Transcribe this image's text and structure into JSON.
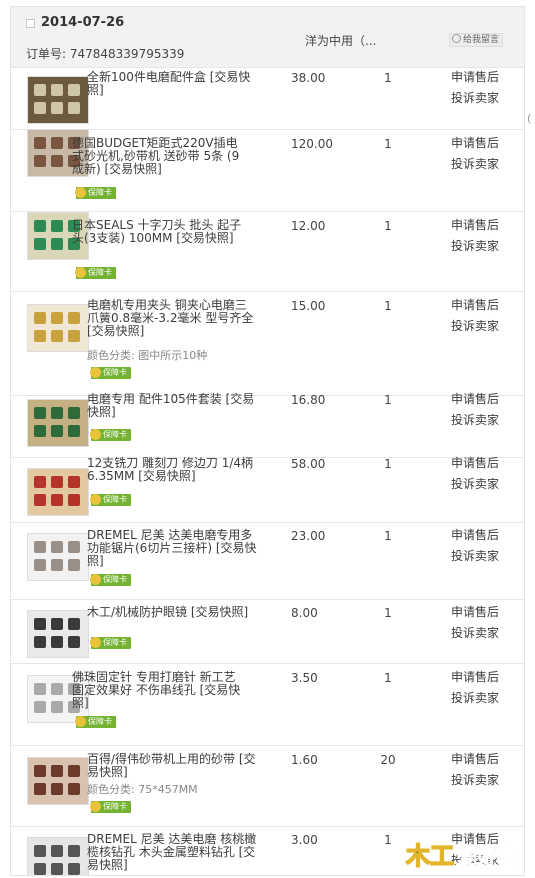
{
  "order": {
    "date": "2014-07-26",
    "order_no": "订单号: 747848339795339",
    "seller": "洋为中用（...",
    "memo": "给我留言"
  },
  "side_char": "(",
  "badge_label": "保障卡",
  "actions": {
    "apply": "申请售后",
    "complain": "投诉卖家"
  },
  "items": [
    {
      "title": "全新100件电磨配件盒 [交易快照]",
      "sku": "",
      "price": "38.00",
      "qty": "1",
      "thumb_colors": [
        "#cfc5a8",
        "#6c5a3c"
      ]
    },
    {
      "title": "德国BUDGET矩距式220V插电式砂光机,砂带机 送砂带 5条 (9成新) [交易快照]",
      "sku": "",
      "price": "120.00",
      "qty": "1",
      "thumb_colors": [
        "#7a5540",
        "#c8b9a6"
      ]
    },
    {
      "title": "日本SEALS 十字刀头 批头 起子头(3支装) 100MM [交易快照]",
      "sku": "",
      "price": "12.00",
      "qty": "1",
      "thumb_colors": [
        "#2d8a54",
        "#d9d7b8"
      ]
    },
    {
      "title": "电磨机专用夹头 铜夹心电磨三爪簧0.8毫米-3.2毫米 型号齐全 [交易快照]",
      "sku": "颜色分类: 图中所示10种",
      "price": "15.00",
      "qty": "1",
      "thumb_colors": [
        "#c9a23e",
        "#f0e8d4"
      ]
    },
    {
      "title": "电磨专用 配件105件套装 [交易快照]",
      "sku": "",
      "price": "16.80",
      "qty": "1",
      "thumb_colors": [
        "#2f6b3a",
        "#c4b083"
      ]
    },
    {
      "title": "12支铣刀 雕刻刀 修边刀 1/4柄 6.35MM [交易快照]",
      "sku": "",
      "price": "58.00",
      "qty": "1",
      "thumb_colors": [
        "#b5342a",
        "#e2c9a0"
      ]
    },
    {
      "title": "DREMEL 尼美 达美电磨专用多功能锯片(6切片三接杆) [交易快照]",
      "sku": "",
      "price": "23.00",
      "qty": "1",
      "thumb_colors": [
        "#9a8f86",
        "#f2f2f2"
      ]
    },
    {
      "title": "木工/机械防护眼镜 [交易快照]",
      "sku": "",
      "price": "8.00",
      "qty": "1",
      "thumb_colors": [
        "#3a3a3a",
        "#e9e9e9"
      ]
    },
    {
      "title": "佛珠固定针 专用打磨针 新工艺 固定效果好 不伤串线孔 [交易快照]",
      "sku": "",
      "price": "3.50",
      "qty": "1",
      "thumb_colors": [
        "#a9a9a9",
        "#f4f4f4"
      ]
    },
    {
      "title": "百得/得伟砂带机上用的砂带 [交易快照]",
      "sku": "颜色分类: 75*457MM",
      "price": "1.60",
      "qty": "20",
      "thumb_colors": [
        "#6b3a2a",
        "#d9c2b0"
      ]
    },
    {
      "title": "DREMEL 尼美 达美电磨 核桃橄榄核钻孔 木头金属塑料钻孔 [交易快照]",
      "sku": "",
      "price": "3.00",
      "qty": "1",
      "thumb_colors": [
        "#555555",
        "#e6e6e6"
      ]
    }
  ],
  "logo": {
    "part1": "木工",
    "part2": "爱好者"
  }
}
